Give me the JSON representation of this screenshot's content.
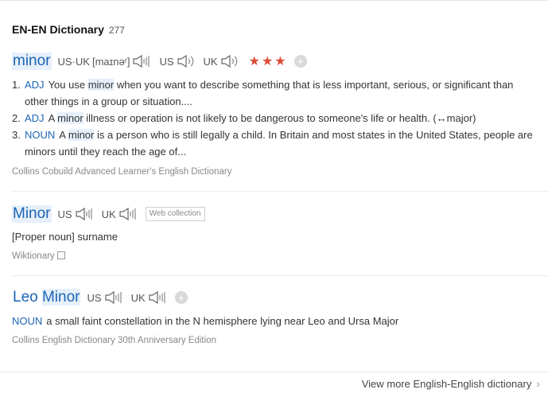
{
  "header": {
    "title": "EN-EN Dictionary",
    "count": "277"
  },
  "entries": [
    {
      "word": "minor",
      "pron": [
        {
          "label": "US·UK",
          "phonetic": "[maɪnəʳ]"
        },
        {
          "label": "US"
        },
        {
          "label": "UK"
        }
      ],
      "stars": "★★★",
      "add": "+",
      "defs": [
        {
          "num": "1.",
          "pos": "ADJ",
          "pre": "You use ",
          "hl": "minor",
          "post": " when you want to describe something that is less important, serious, or significant than other things in a group or situation...."
        },
        {
          "num": "2.",
          "pos": "ADJ",
          "pre": "A ",
          "hl": "minor",
          "post": " illness or operation is not likely to be dangerous to someone's life or health. (↔major)"
        },
        {
          "num": "3.",
          "pos": "NOUN",
          "pre": "A ",
          "hl": "minor",
          "post": " is a person who is still legally a child. In Britain and most states in the United States, people are minors until they reach the age of..."
        }
      ],
      "source": "Collins Cobuild Advanced Learner's English Dictionary"
    },
    {
      "word": "Minor",
      "pron": [
        {
          "label": "US"
        },
        {
          "label": "UK"
        }
      ],
      "tag": "Web collection",
      "def": "[Proper noun] surname",
      "source": "Wiktionary"
    },
    {
      "word_pre": "Leo ",
      "word_hl": "Minor",
      "pron": [
        {
          "label": "US"
        },
        {
          "label": "UK"
        }
      ],
      "add": "+",
      "pos": "NOUN",
      "def": "a small faint constellation in the N hemisphere lying near Leo and Ursa Major",
      "source": "Collins English Dictionary 30th Anniversary Edition"
    }
  ],
  "footer": {
    "view_more": "View more English-English dictionary",
    "chevron": "›"
  },
  "colors": {
    "accent": "#1c64b4",
    "highlight": "#e6f0fb",
    "stars": "#dd4b39"
  }
}
